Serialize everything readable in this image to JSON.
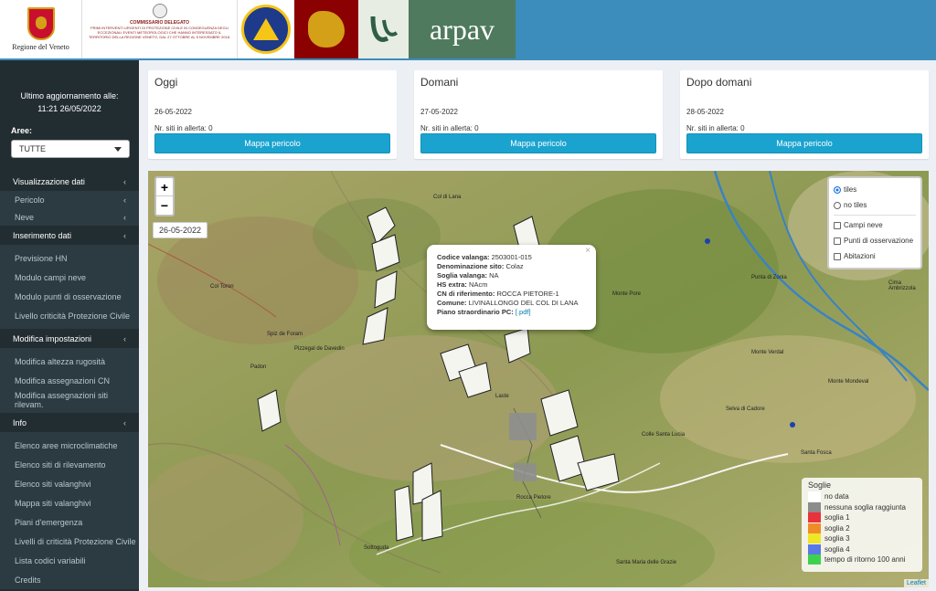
{
  "header": {
    "veneto_label": "Regione del Veneto",
    "commissario_title": "COMMISSARIO DELEGATO",
    "commissario_text": "PRIMI INTERVENTI URGENTI DI PROTEZIONE CIVILE IN CONSEGUENZA DEGLI ECCEZIONALI EVENTI METEOROLOGICI CHE HANNO INTERESSATO IL TERRITORIO DELLA REGIONE VENETO, DAL 27 OTTOBRE AL 5 NOVEMBRE 2018.",
    "arpav_label": "arpav"
  },
  "sidebar": {
    "update_label": "Ultimo aggiornamento alle:",
    "update_time": "11:21 26/05/2022",
    "aree_label": "Aree:",
    "aree_value": "TUTTE",
    "menu": {
      "visualizzazione": "Visualizzazione dati",
      "pericolo": "Pericolo",
      "neve": "Neve",
      "inserimento": "Inserimento dati",
      "inserimento_items": [
        "Previsione HN",
        "Modulo campi neve",
        "Modulo punti di osservazione",
        "Livello criticità Protezione Civile"
      ],
      "modifica": "Modifica impostazioni",
      "modifica_items": [
        "Modifica altezza rugosità",
        "Modifica assegnazioni CN",
        "Modifica assegnazioni siti rilevam."
      ],
      "info": "Info",
      "info_items": [
        "Elenco aree microclimatiche",
        "Elenco siti di rilevamento",
        "Elenco siti valanghivi",
        "Mappa siti valanghivi",
        "Piani d'emergenza",
        "Livelli di criticità Protezione Civile",
        "Lista codici variabili",
        "Credits"
      ]
    }
  },
  "cards": [
    {
      "title": "Oggi",
      "date": "26-05-2022",
      "alert": "Nr. siti in allerta: 0",
      "button": "Mappa pericolo"
    },
    {
      "title": "Domani",
      "date": "27-05-2022",
      "alert": "Nr. siti in allerta: 0",
      "button": "Mappa pericolo"
    },
    {
      "title": "Dopo domani",
      "date": "28-05-2022",
      "alert": "Nr. siti in allerta: 0",
      "button": "Mappa pericolo"
    }
  ],
  "map": {
    "zoom_in": "+",
    "zoom_out": "−",
    "date": "26-05-2022",
    "popup": {
      "close": "×",
      "codice_label": "Codice valanga:",
      "codice": "2503001-015",
      "denom_label": "Denominazione sito:",
      "denom": "Colaz",
      "soglia_label": "Soglia valanga:",
      "soglia": "NA",
      "hs_label": "HS extra:",
      "hs": "NAcm",
      "cn_label": "CN di riferimento:",
      "cn": "ROCCA PIETORE-1",
      "comune_label": "Comune:",
      "comune": "LIVINALLONGO DEL COL DI LANA",
      "piano_label": "Piano straordinario PC:",
      "piano": "[.pdf]"
    },
    "layers": {
      "tiles": "tiles",
      "no_tiles": "no tiles",
      "campi_neve": "Campi neve",
      "punti": "Punti di osservazione",
      "abitazioni": "Abitazioni"
    },
    "legend": {
      "title": "Soglie",
      "items": [
        {
          "label": "no data",
          "color": "#ffffff"
        },
        {
          "label": "nessuna soglia raggiunta",
          "color": "#8c8c8c"
        },
        {
          "label": "soglia 1",
          "color": "#e8323c"
        },
        {
          "label": "soglia 2",
          "color": "#f08c28"
        },
        {
          "label": "soglia 3",
          "color": "#f0e628"
        },
        {
          "label": "soglia 4",
          "color": "#5a78e6"
        },
        {
          "label": "tempo di ritorno 100 anni",
          "color": "#3cd250"
        }
      ]
    },
    "attribution": "Leaflet",
    "places": [
      "Rocca Pietore",
      "Selva di Cadore",
      "Colle Santa Lucia",
      "Santa Fosca",
      "Sottoguda",
      "Santa Maria delle Grazie",
      "Col di Lana",
      "Laste",
      "Padon",
      "Col Toron",
      "Monte Pore",
      "Punta di Zonia",
      "Monte Mondeval",
      "Cima Ambrizzola",
      "Monte Verdal",
      "Spiz de Foram",
      "Pizzegal de Davedin"
    ]
  }
}
